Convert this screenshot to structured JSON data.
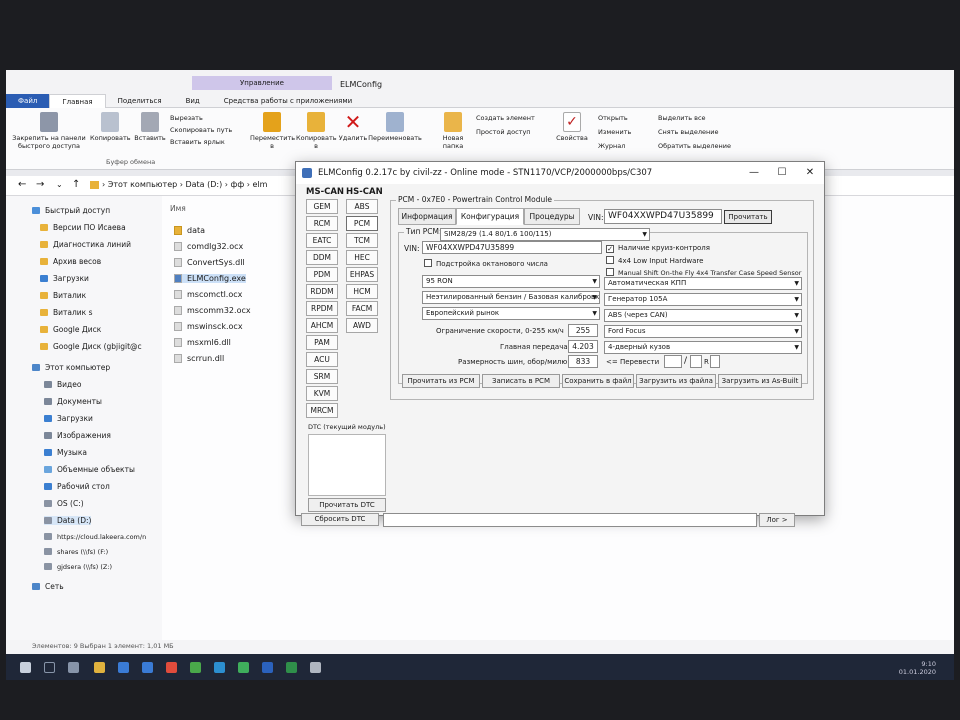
{
  "explorer": {
    "ribbon_context": "Управление",
    "window_title": "ELMConfig",
    "tabs": [
      "Файл",
      "Главная",
      "Поделиться",
      "Вид",
      "Средства работы с приложениями"
    ],
    "ribbon": {
      "pin_label": "Закрепить на панели быстрого доступа",
      "copy": "Копировать",
      "paste": "Вставить",
      "cut": "Вырезать",
      "copy_path": "Скопировать путь",
      "paste_shortcut": "Вставить ярлык",
      "clipboard_group": "Буфер обмена",
      "move_to": "Переместить в",
      "copy_to": "Копировать в",
      "delete": "Удалить",
      "rename": "Переименовать",
      "new_folder": "Новая папка",
      "new_item": "Создать элемент",
      "easy_access": "Простой доступ",
      "properties": "Свойства",
      "open": "Открыть",
      "edit": "Изменить",
      "history": "Журнал",
      "select_all": "Выделить все",
      "select_none": "Снять выделение",
      "invert_selection": "Обратить выделение"
    },
    "breadcrumb": "›   Этот компьютер  ›  Data (D:)  ›  фф  ›  elm",
    "nav": [
      "Быстрый доступ",
      "Версии ПО Исаева",
      "Диагностика линий",
      "Архив весов",
      "Загрузки",
      "Виталик",
      "Виталик s",
      "Google Диск",
      "Google Диск (gbjigit@c",
      "Этот компьютер",
      "Видео",
      "Документы",
      "Загрузки",
      "Изображения",
      "Музыка",
      "Объемные объекты",
      "Рабочий стол",
      "OS (C:)",
      "Data (D:)",
      "https://cloud.lakeera.com/n",
      "shares (\\\\fs) (F:)",
      "gjdsera (\\\\fs) (Z:)",
      "Сеть"
    ],
    "col_name": "Имя",
    "files": [
      "data",
      "comdlg32.ocx",
      "ConvertSys.dll",
      "ELMConfig.exe",
      "mscomctl.ocx",
      "mscomm32.ocx",
      "mswinsck.ocx",
      "msxml6.dll",
      "scrrun.dll"
    ],
    "status": "Элементов: 9      Выбран 1 элемент: 1,01 МБ",
    "clock_time": "9:10",
    "clock_date": "01.01.2020"
  },
  "elm": {
    "title": "ELMConfig 0.2.17c by civil-zz - Online mode - STN1170/VCP/2000000bps/C307",
    "ms_can_header": "MS-CAN",
    "hs_can_header": "HS-CAN",
    "ms_can": [
      "GEM",
      "RCM",
      "EATC",
      "DDM",
      "PDM",
      "RDDM",
      "RPDM",
      "AHCM",
      "PAM",
      "ACU",
      "SRM",
      "KVM",
      "MRCM"
    ],
    "hs_can": [
      "ABS",
      "PCM",
      "TCM",
      "HEC",
      "EHPAS",
      "HCM",
      "FACM",
      "AWD"
    ],
    "dtc_legend": "DTC (текущий модуль)",
    "read_dtc": "Прочитать DTC",
    "clear_dtc": "Сбросить DTC",
    "pcm_legend": "PCM - 0x7E0 - Powertrain Control Module",
    "tabs": [
      "Информация",
      "Конфигурация",
      "Процедуры"
    ],
    "vin_label": "VIN:",
    "vin_value": "WF04XXWPD47U35899",
    "read_button": "Прочитать",
    "pcm_type_legend": "Тип PCM:",
    "pcm_type": "SIM28/29 (1.4 80/1.6 100/115)",
    "inner_vin_label": "VIN:",
    "inner_vin_value": "WF04XXWPD47U35899",
    "octane_adapt": "Подстройка октанового числа",
    "cruise": "Наличие круиз-контроля",
    "low_input": "4x4 Low Input Hardware",
    "manual_shift": "Manual Shift On-the Fly 4x4 Transfer Case Speed Sensor",
    "fuel": "95 RON",
    "fuel_cal": "Неэтилированный бензин / Базовая калибровка",
    "market": "Европейский рынок",
    "transmission": "Автоматическая КПП",
    "generator": "Генератор 105A",
    "abs": "ABS (через CAN)",
    "brand": "Ford Focus",
    "body": "4-дверный кузов",
    "speed_limit_label": "Ограничение скорости, 0-255 км/ч",
    "speed_limit": "255",
    "final_drive_label": "Главная передача",
    "final_drive": "4.203",
    "tire_label": "Размерность шин, обор/милю",
    "tire": "833",
    "convert_label": "<= Перевести",
    "r_label": "R",
    "btn_read_pcm": "Прочитать из PCM",
    "btn_write_pcm": "Записать в PCM",
    "btn_save": "Сохранить в файл",
    "btn_load": "Загрузить из файла",
    "btn_load_asbuilt": "Загрузить из As-Built",
    "log_button": "Лог >"
  }
}
